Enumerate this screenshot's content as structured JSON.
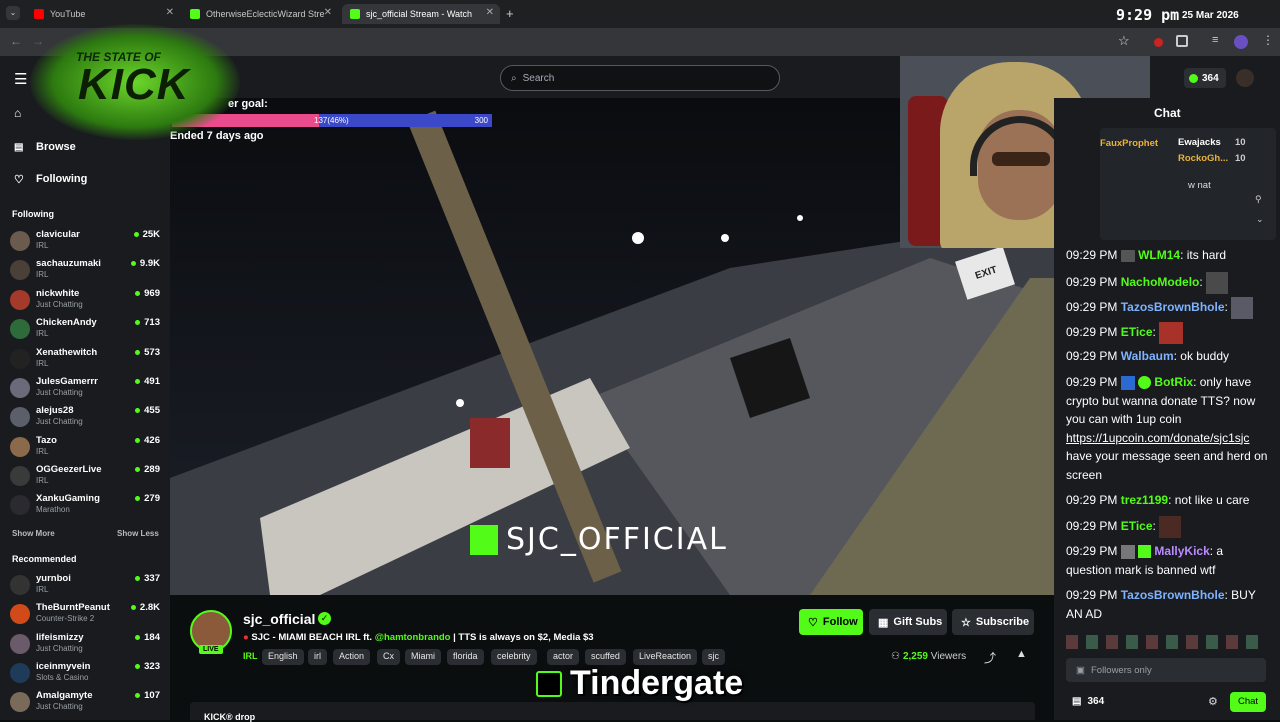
{
  "browser": {
    "tabs": [
      {
        "title": "YouTube",
        "color": "#ff0000"
      },
      {
        "title": "OtherwiseEclecticWizard Stream",
        "color": "#53fc18"
      },
      {
        "title": "sjc_official Stream - Watch",
        "color": "#53fc18"
      }
    ],
    "new_tab": "+"
  },
  "clock": {
    "time": "9:29 pm",
    "date": "25 Mar 2026"
  },
  "logo": {
    "line1": "THE STATE OF",
    "line2": "KICK"
  },
  "header": {
    "search_placeholder": "Search",
    "points": "364"
  },
  "sidebar": {
    "nav": [
      {
        "label": "Browse",
        "icon": "compass-icon"
      },
      {
        "label": "Following",
        "icon": "heart-icon"
      }
    ],
    "following_title": "Following",
    "following": [
      {
        "name": "clavicular",
        "category": "IRL",
        "viewers": "25K"
      },
      {
        "name": "sachauzumaki",
        "category": "IRL",
        "viewers": "9.9K"
      },
      {
        "name": "nickwhite",
        "category": "Just Chatting",
        "viewers": "969"
      },
      {
        "name": "ChickenAndy",
        "category": "IRL",
        "viewers": "713"
      },
      {
        "name": "Xenathewitch",
        "category": "IRL",
        "viewers": "573"
      },
      {
        "name": "JulesGamerrr",
        "category": "Just Chatting",
        "viewers": "491"
      },
      {
        "name": "alejus28",
        "category": "Just Chatting",
        "viewers": "455"
      },
      {
        "name": "Tazo",
        "category": "IRL",
        "viewers": "426"
      },
      {
        "name": "OGGeezerLive",
        "category": "IRL",
        "viewers": "289"
      },
      {
        "name": "XankuGaming",
        "category": "Marathon",
        "viewers": "279"
      }
    ],
    "show_more": "Show More",
    "show_less": "Show Less",
    "recommended_title": "Recommended",
    "recommended": [
      {
        "name": "yurnboi",
        "category": "IRL",
        "viewers": "337"
      },
      {
        "name": "TheBurntPeanut",
        "category": "Counter-Strike 2",
        "viewers": "2.8K"
      },
      {
        "name": "lifeismizzy",
        "category": "Just Chatting",
        "viewers": "184"
      },
      {
        "name": "iceinmyvein",
        "category": "Slots & Casino",
        "viewers": "323"
      },
      {
        "name": "Amalgamyte",
        "category": "Just Chatting",
        "viewers": "107"
      }
    ]
  },
  "goal": {
    "label": "er goal:",
    "progress_text": "137(46%)",
    "target": "300",
    "progress_fraction": 0.46,
    "ended": "Ended 7 days ago"
  },
  "video": {
    "watermark": "SJC_OFFICIAL",
    "exit_sign": "EXIT"
  },
  "stream": {
    "channel": "sjc_official",
    "live_badge": "LIVE",
    "title_prefix": "SJC - MIAMI BEACH IRL ft. ",
    "title_mention": "@hamtonbrando",
    "title_suffix": " | TTS is always on $2, Media $3",
    "tags": [
      "IRL",
      "English",
      "irl",
      "Action",
      "Cx",
      "Miami",
      "florida",
      "celebrity",
      "actor",
      "scuffed",
      "LiveReaction",
      "sjc"
    ],
    "follow_label": "Follow",
    "gift_label": "Gift Subs",
    "subscribe_label": "Subscribe",
    "viewers": "2,259",
    "viewers_label": "Viewers",
    "drops_label": "KICK® drop"
  },
  "caption": {
    "text": "Tindergate"
  },
  "chat": {
    "title": "Chat",
    "overlay_users": [
      {
        "name": "FauxProphet"
      },
      {
        "name": "Ewajacks",
        "count": "10"
      },
      {
        "name": "RockoGh...",
        "count": "10"
      }
    ],
    "overlay_snippet": "w nat",
    "messages": [
      {
        "time": "09:29 PM",
        "user": "WLM14",
        "color": "#53fc18",
        "text": ": its hard"
      },
      {
        "time": "09:29 PM",
        "user": "NachoModelo",
        "color": "#53fc18",
        "text": ":"
      },
      {
        "time": "09:29 PM",
        "user": "TazosBrownBhole",
        "color": "#7fb2ff",
        "text": ":"
      },
      {
        "time": "09:29 PM",
        "user": "ETice",
        "color": "#53fc18",
        "text": ":"
      },
      {
        "time": "09:29 PM",
        "user": "Walbaum",
        "color": "#7fb2ff",
        "text": ": ok buddy"
      },
      {
        "time": "09:29 PM",
        "user": "BotRix",
        "color": "#53fc18",
        "text": ": only have crypto but wanna donate TTS? now you can with 1up coin",
        "link": "https://1upcoin.com/donate/sjc1sjc",
        "after": "have your message seen and herd on screen"
      },
      {
        "time": "09:29 PM",
        "user": "trez1199",
        "color": "#53fc18",
        "text": ": not like u care"
      },
      {
        "time": "09:29 PM",
        "user": "ETice",
        "color": "#53fc18",
        "text": ":"
      },
      {
        "time": "09:29 PM",
        "user": "MallyKick",
        "color": "#b98cff",
        "text": ": a question mark is banned wtf"
      },
      {
        "time": "09:29 PM",
        "user": "TazosBrownBhole",
        "color": "#7fb2ff",
        "text": ": BUY AN AD"
      }
    ],
    "input_placeholder": "Followers only",
    "points": "364",
    "send_label": "Chat"
  }
}
